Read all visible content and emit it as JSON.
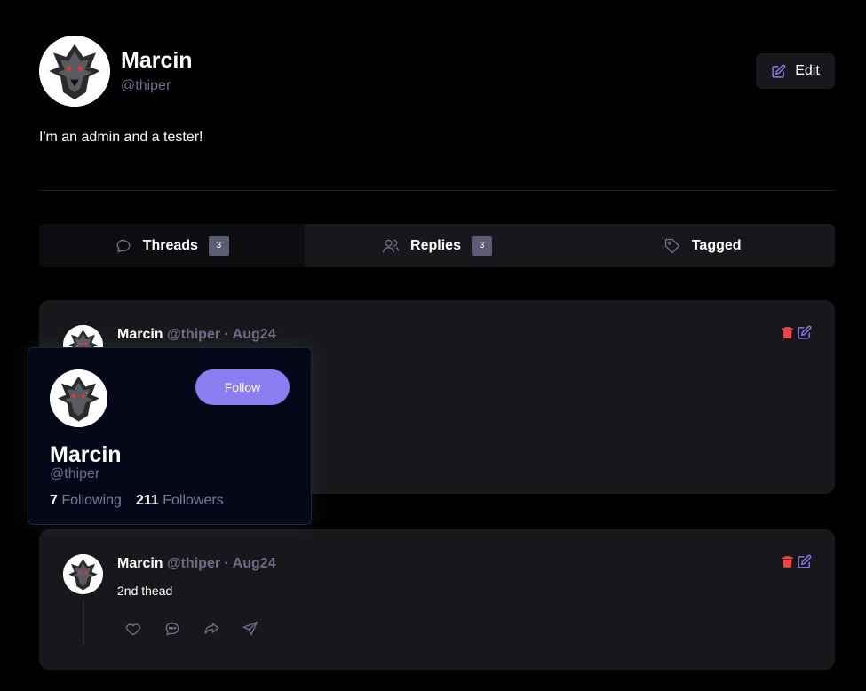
{
  "profile": {
    "name": "Marcin",
    "handle": "@thiper",
    "bio": "I'm an admin and a tester!",
    "edit_label": "Edit"
  },
  "tabs": [
    {
      "label": "Threads",
      "count": "3",
      "icon": "chat-bubble-icon"
    },
    {
      "label": "Replies",
      "count": "3",
      "icon": "users-icon"
    },
    {
      "label": "Tagged",
      "icon": "tag-icon"
    }
  ],
  "threads": [
    {
      "author": "Marcin",
      "meta": "@thiper · Aug24",
      "text": ""
    },
    {
      "author": "Marcin",
      "meta": "@thiper · Aug24",
      "text": "2nd thead"
    }
  ],
  "hovercard": {
    "name": "Marcin",
    "handle": "@thiper",
    "follow_label": "Follow",
    "following_count": "7",
    "following_label": "Following",
    "followers_count": "211",
    "followers_label": "Followers"
  },
  "colors": {
    "accent": "#8b7cf2",
    "danger": "#ef4444",
    "background": "#000000",
    "card": "#18181c"
  }
}
